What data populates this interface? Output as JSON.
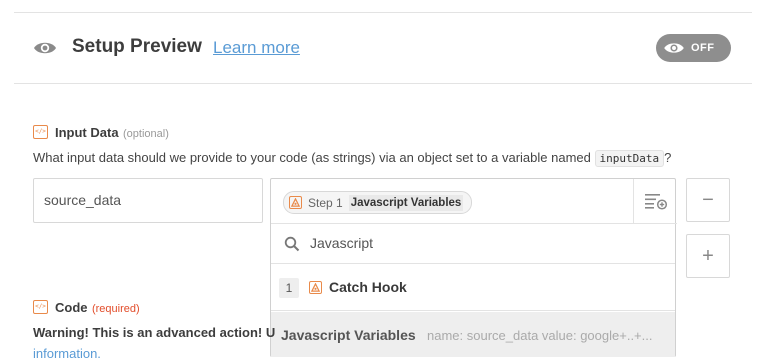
{
  "header": {
    "title": "Setup Preview",
    "learn_more": "Learn more",
    "toggle_label": "OFF",
    "icon": "eye-icon"
  },
  "input_data": {
    "label": "Input Data",
    "qualifier": "(optional)",
    "description": "What input data should we provide to your code (as strings) via an object set to a variable named",
    "variable_name": "inputData",
    "description_suffix": "?",
    "key_value": "source_data",
    "selected_step": "Step 1",
    "selected_field": "Javascript Variables",
    "search_value": "Javascript",
    "options": [
      {
        "number": "1",
        "label": "Catch Hook"
      },
      {
        "label": "Javascript Variables",
        "detail": "name: source_data value: google+..+..."
      }
    ],
    "remove_button": "−",
    "add_button": "+"
  },
  "code": {
    "label": "Code",
    "qualifier": "(required)",
    "warning": "Warning! This is an advanced action! U",
    "link": "information."
  },
  "colors": {
    "accent_orange": "#e98a4a",
    "link_blue": "#5a9bd5",
    "required_red": "#e24d2b",
    "toggle_gray": "#8e8e8e"
  }
}
